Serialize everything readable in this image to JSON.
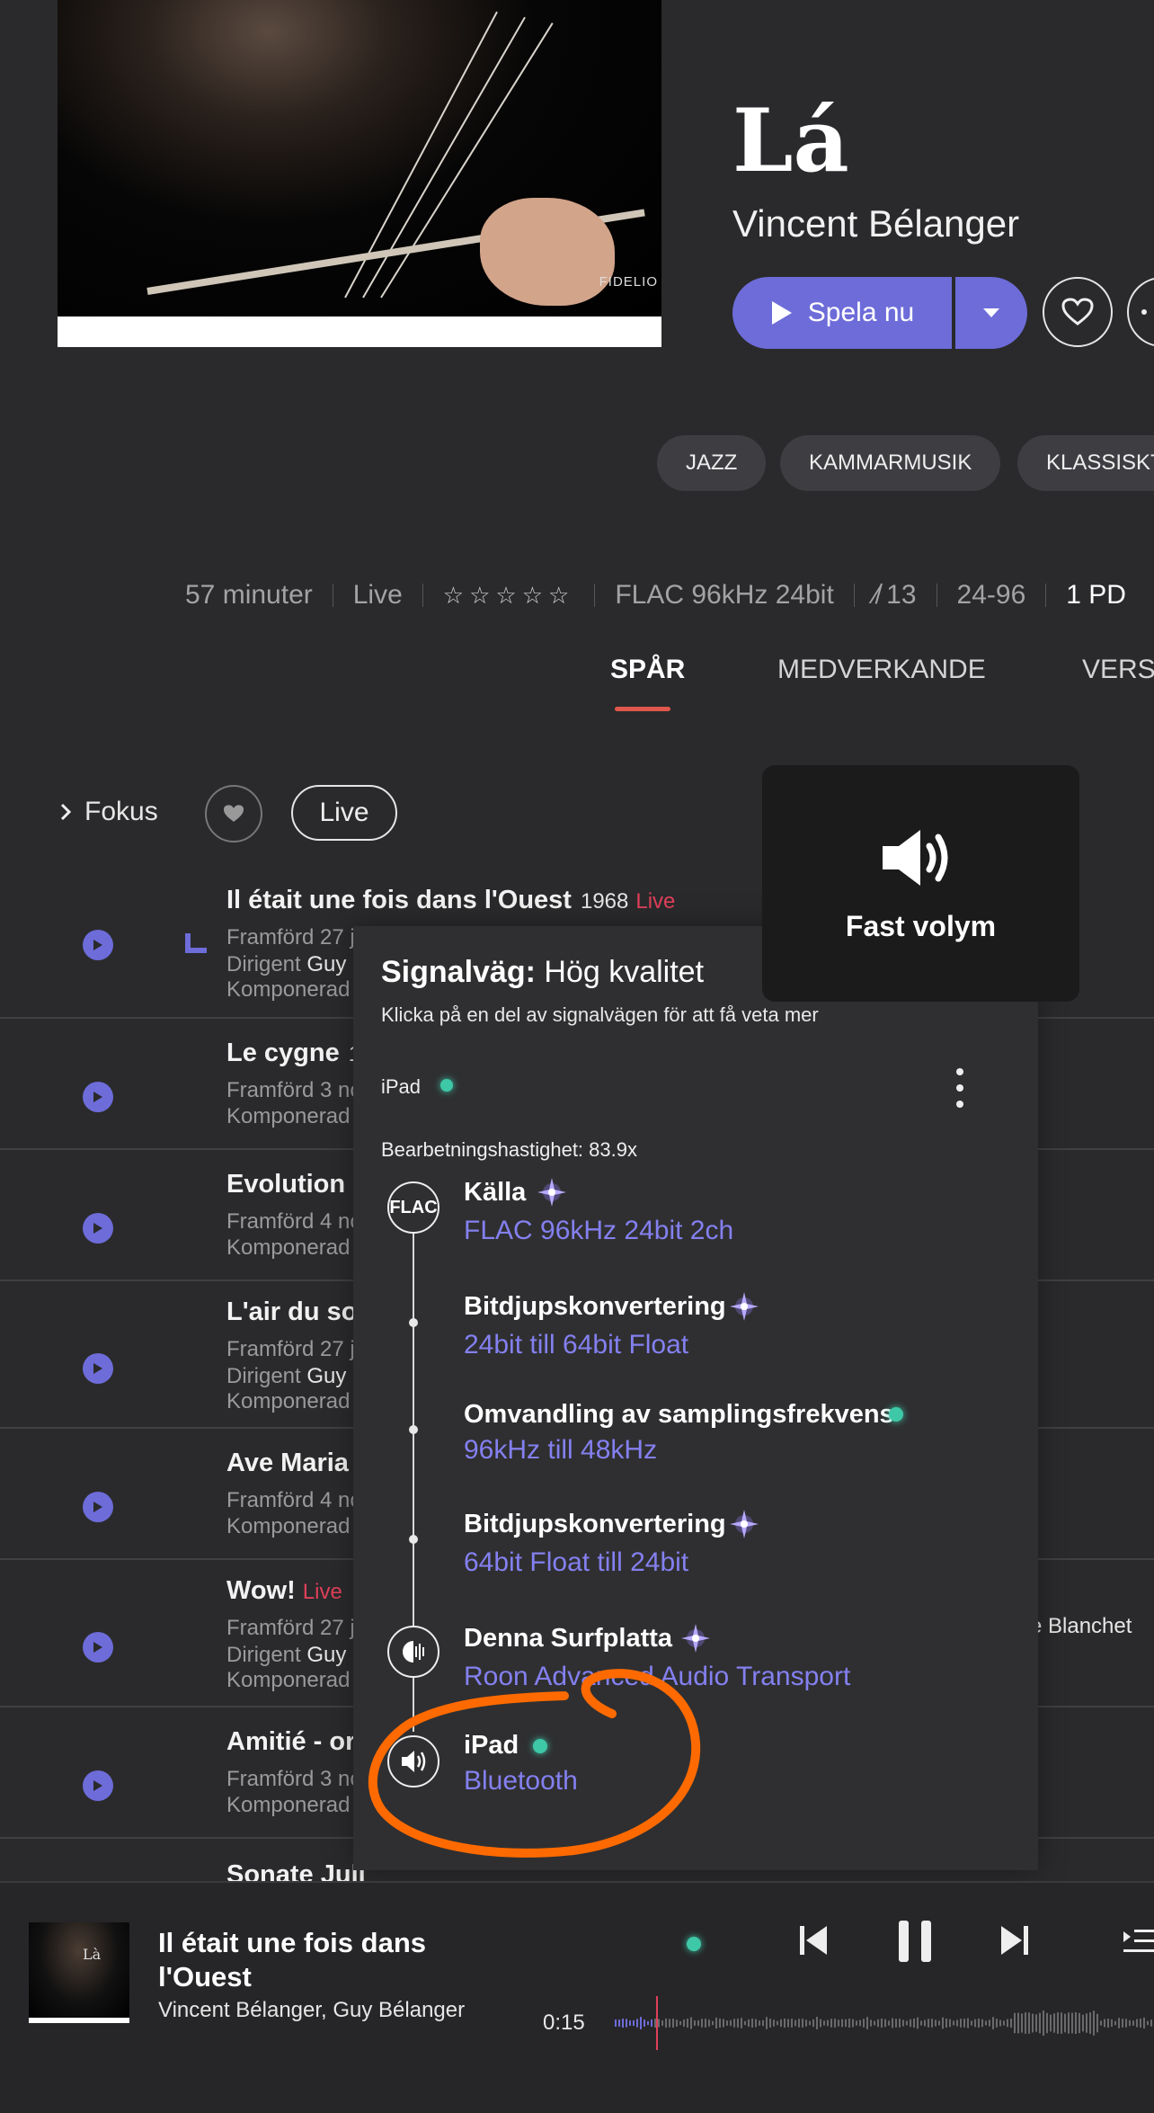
{
  "album": {
    "title": "Lá",
    "artist": "Vincent Bélanger",
    "cover_brand": "FIDELIO",
    "play_label": "Spela nu",
    "genres": [
      "JAZZ",
      "KAMMARMUSIK",
      "KLASSISKT"
    ]
  },
  "meta": {
    "duration": "57 minuter",
    "type": "Live",
    "rating_stars": 0,
    "format": "FLAC 96kHz 24bit",
    "tracks_count": "13",
    "bitdepth_rate": "24-96",
    "disc": "1 PD"
  },
  "tabs": [
    "SPÅR",
    "MEDVERKANDE",
    "VERSI"
  ],
  "filters": {
    "focus_label": "Fokus",
    "live_label": "Live"
  },
  "volume_popup": {
    "label": "Fast volym"
  },
  "tracks": [
    {
      "title": "Il était une fois dans l'Ouest",
      "year": "1968",
      "live": "Live",
      "line1": "Framförd 27 j",
      "line2_label": "Dirigent",
      "line2_value": "Guy",
      "line3": "Komponerad"
    },
    {
      "title": "Le cygne",
      "year": "1",
      "line1": "Framförd 3 nc",
      "line3": "Komponerad"
    },
    {
      "title": "Evolution -",
      "line1": "Framförd 4 nc",
      "line3": "Komponerad"
    },
    {
      "title": "L'air du soi",
      "line1": "Framförd 27 j",
      "line2_label": "Dirigent",
      "line2_value": "Guy",
      "line3": "Komponerad"
    },
    {
      "title": "Ave Maria",
      "line1": "Framförd 4 nc",
      "line3": "Komponerad"
    },
    {
      "title": "Wow!",
      "live": "Live",
      "line1": "Framförd 27 j",
      "line2_label": "Dirigent",
      "line2_value": "Guy",
      "line3": "Komponerad",
      "extra": "e Blanchet"
    },
    {
      "title": "Amitié - or",
      "line1": "Framförd 3 nc",
      "line3": "Komponerad"
    },
    {
      "title": "Sonate Juli"
    }
  ],
  "signal_path": {
    "title_bold": "Signalväg:",
    "title_rest": " Hög kvalitet",
    "subtitle": "Klicka på en del av signalvägen för att få veta mer",
    "device": "iPad",
    "speed": "Bearbetningshastighet: 83.9x",
    "source_icon": "FLAC",
    "steps": [
      {
        "title": "Källa",
        "detail": "FLAC 96kHz 24bit 2ch",
        "quality": "purple"
      },
      {
        "title": "Bitdjupskonvertering",
        "detail": "24bit till 64bit Float",
        "quality": "purple"
      },
      {
        "title": "Omvandling av samplingsfrekvens",
        "detail": "96kHz till 48kHz",
        "quality": "green"
      },
      {
        "title": "Bitdjupskonvertering",
        "detail": "64bit Float till 24bit",
        "quality": "purple"
      },
      {
        "title": "Denna Surfplatta",
        "detail": "Roon Advanced Audio Transport",
        "quality": "purple"
      },
      {
        "title": "iPad",
        "detail": "Bluetooth",
        "quality": "green"
      }
    ]
  },
  "player": {
    "title": "Il était une fois dans l'Ouest",
    "artist": "Vincent Bélanger, Guy Bélanger",
    "elapsed": "0:15",
    "thumb_text": "Là"
  },
  "colors": {
    "accent": "#6d6cd9",
    "highlight_red": "#e0574d",
    "annotation": "#ff6a00",
    "quality_green": "#3ec8a8"
  }
}
